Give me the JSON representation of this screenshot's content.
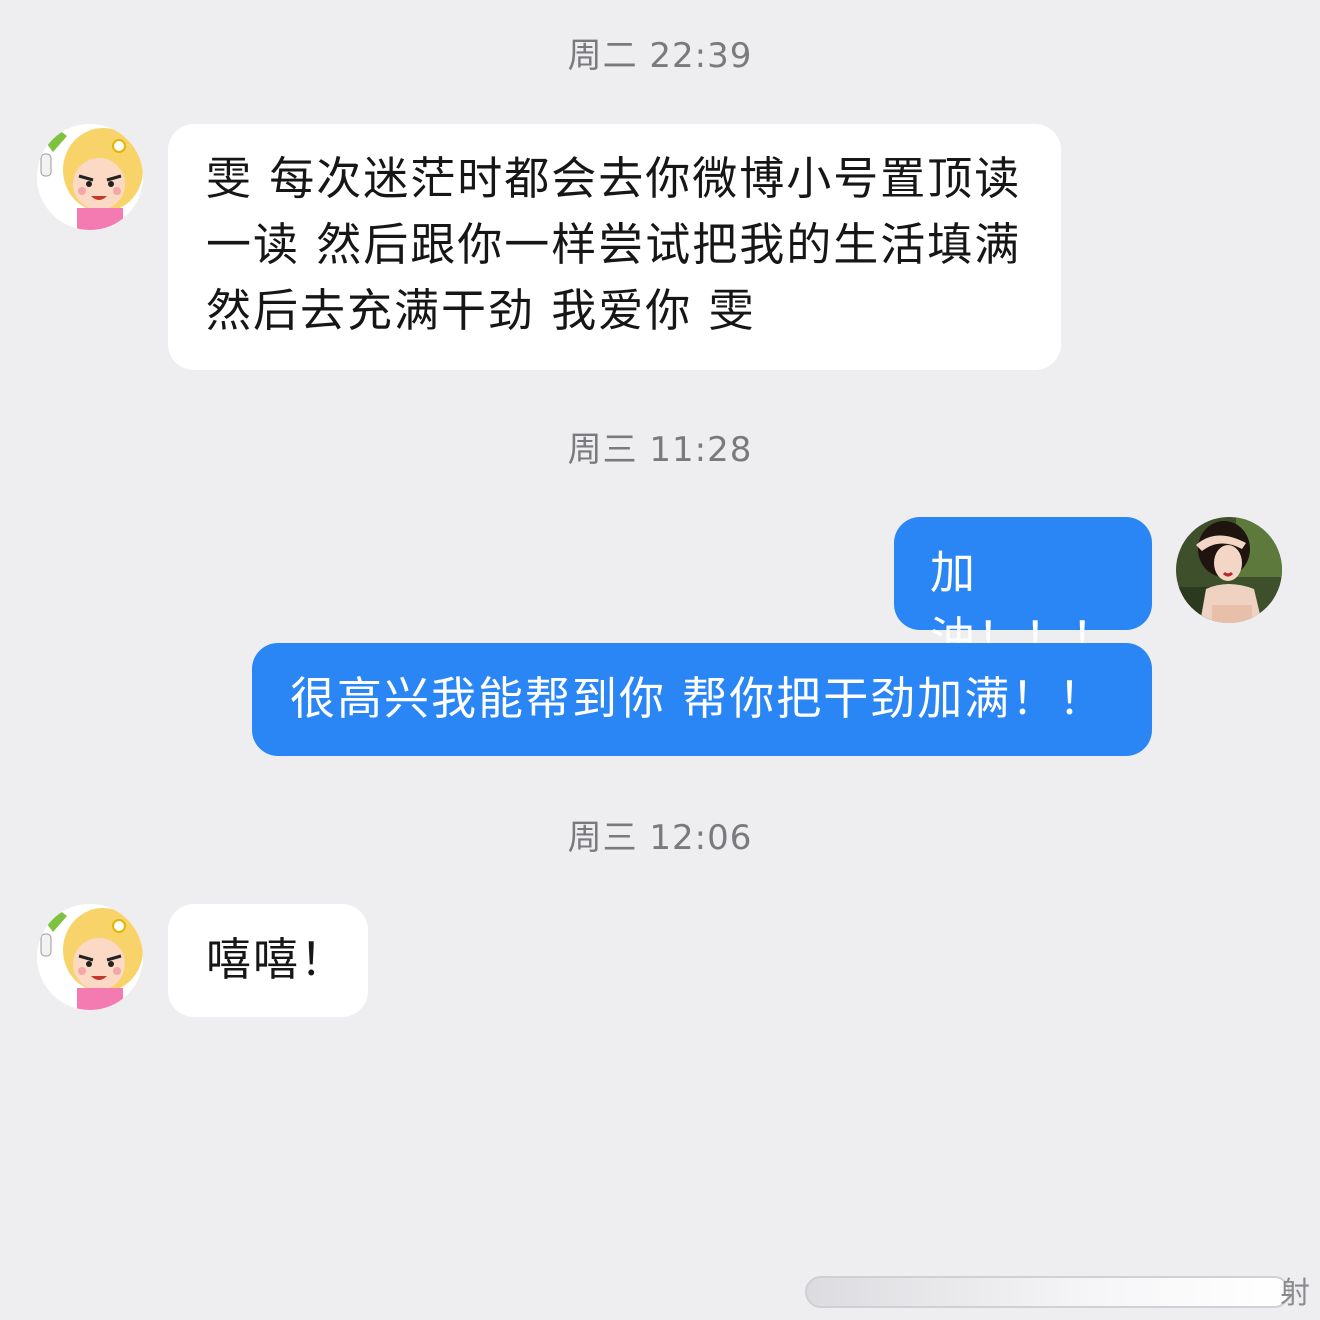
{
  "conversation": [
    {
      "type": "timestamp",
      "text": "周二 22:39"
    },
    {
      "type": "message",
      "sender": "contact",
      "avatar": "cartoon-girl-avatar",
      "text": "雯 每次迷茫时都会去你微博小号置顶读一读 然后跟你一样尝试把我的生活填满 然后去充满干劲 我爱你 雯"
    },
    {
      "type": "timestamp",
      "text": "周三 11:28"
    },
    {
      "type": "message",
      "sender": "self",
      "avatar": "woman-photo-avatar",
      "text": "加油！！！"
    },
    {
      "type": "message",
      "sender": "self",
      "text": "很高兴我能帮到你 帮你把干劲加满！！"
    },
    {
      "type": "timestamp",
      "text": "周三 12:06"
    },
    {
      "type": "message",
      "sender": "contact",
      "avatar": "cartoon-girl-avatar",
      "text": "嘻嘻！"
    }
  ],
  "watermark": {
    "text": "射"
  },
  "colors": {
    "background": "#eeeef0",
    "incoming_bubble": "#ffffff",
    "outgoing_bubble": "#2b86f5",
    "timestamp": "#7a7a7e"
  }
}
